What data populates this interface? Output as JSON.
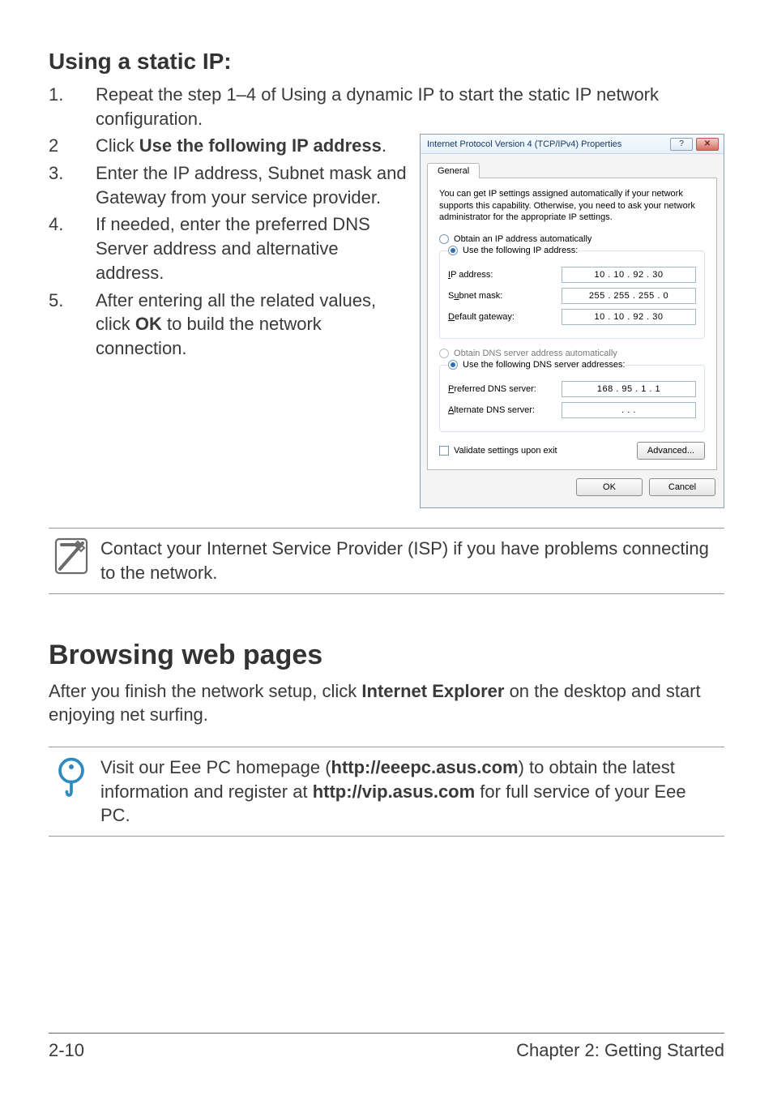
{
  "section1": {
    "heading": "Using a static IP:",
    "steps": [
      {
        "num": "1.",
        "text": "Repeat the step 1–4 of Using a dynamic IP to start the static IP network configuration."
      },
      {
        "num": "2",
        "text_before": "Click ",
        "bold": "Use the following IP address",
        "text_after": "."
      },
      {
        "num": "3.",
        "text": "Enter the IP address, Subnet mask and Gateway from your service provider."
      },
      {
        "num": "4.",
        "text": "If needed, enter the preferred DNS Server address and alternative address."
      },
      {
        "num": "5.",
        "text_before": "After entering all the related values, click ",
        "bold": "OK",
        "text_after": " to build the network connection."
      }
    ]
  },
  "note1": {
    "text": "Contact your Internet Service Provider (ISP) if you have problems connecting to the network."
  },
  "section2": {
    "heading": "Browsing web pages",
    "intro_before": "After you finish the network setup, click ",
    "intro_bold": "Internet Explorer",
    "intro_after": " on the desktop and start enjoying net surfing."
  },
  "tip": {
    "p1_before": "Visit our Eee PC homepage (",
    "p1_bold1": "http://eeepc.asus.com",
    "p1_mid": ") to obtain the latest information and register at ",
    "p1_bold2": "http://vip.asus.com",
    "p1_after": " for full service of your Eee PC."
  },
  "footer": {
    "left": "2-10",
    "right": "Chapter 2: Getting Started"
  },
  "dialog": {
    "title": "Internet Protocol Version 4 (TCP/IPv4) Properties",
    "help_btn": "?",
    "close_btn": "✕",
    "tab": "General",
    "description": "You can get IP settings assigned automatically if your network supports this capability. Otherwise, you need to ask your network administrator for the appropriate IP settings.",
    "radio_auto_ip": "Obtain an IP address automatically",
    "radio_static_ip": "Use the following IP address:",
    "ip_label": "IP address:",
    "ip_value": "10 . 10 . 92 . 30",
    "subnet_label": "Subnet mask:",
    "subnet_value": "255 . 255 . 255 .  0",
    "gateway_label": "Default gateway:",
    "gateway_value": "10 . 10 . 92 . 30",
    "radio_auto_dns": "Obtain DNS server address automatically",
    "radio_static_dns": "Use the following DNS server addresses:",
    "pref_dns_label": "Preferred DNS server:",
    "pref_dns_value": "168 . 95 .  1 .  1",
    "alt_dns_label": "Alternate DNS server:",
    "alt_dns_value": ".       .       .",
    "validate": "Validate settings upon exit",
    "advanced": "Advanced...",
    "ok": "OK",
    "cancel": "Cancel"
  }
}
